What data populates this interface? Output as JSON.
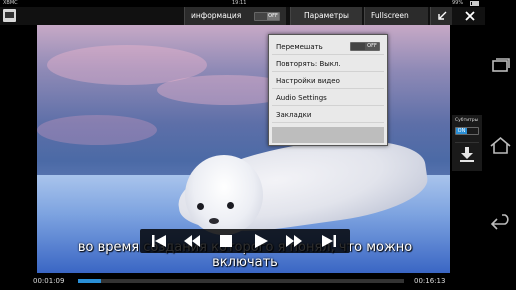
{
  "status_bar": {
    "app": "XBMC",
    "time": "19:11",
    "battery": "99%"
  },
  "top_bar": {
    "info_label": "информация",
    "info_toggle": "OFF",
    "params_label": "Параметры",
    "fullscreen_label": "Fullscreen"
  },
  "params_menu": {
    "items": [
      {
        "label": "Перемешать",
        "toggle": "OFF"
      },
      {
        "label": "Повторять: Выкл."
      },
      {
        "label": "Настройки видео"
      },
      {
        "label": "Audio Settings"
      },
      {
        "label": "Закладки"
      }
    ]
  },
  "subtitles_panel": {
    "label": "Субтитры",
    "toggle": "ON"
  },
  "subtitle_text": "во время создания которого я понял, что можно включать",
  "playback": {
    "current_time": "00:01:09",
    "total_time": "00:16:13",
    "progress": 0.07
  },
  "icons": {
    "transport": [
      "skip-previous-icon",
      "rewind-icon",
      "stop-icon",
      "play-icon",
      "fast-forward-icon",
      "skip-next-icon"
    ],
    "nav": [
      "recent-apps-icon",
      "home-icon",
      "back-icon"
    ]
  },
  "colors": {
    "accent": "#2a8fd6"
  }
}
